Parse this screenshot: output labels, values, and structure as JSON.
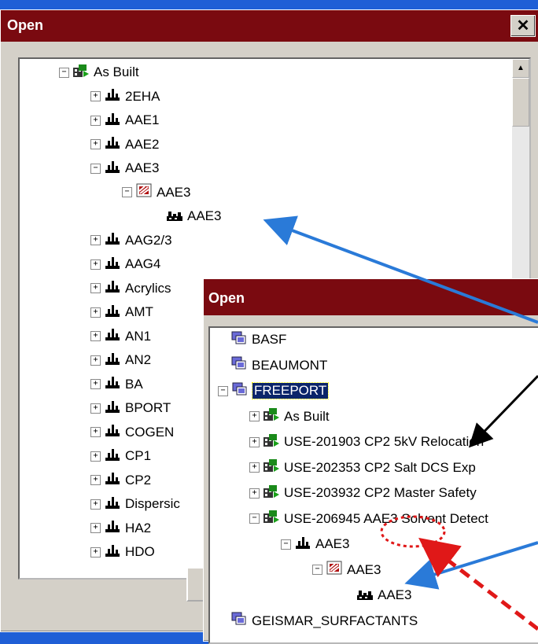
{
  "dialog_back": {
    "title": "Open",
    "close_glyph": "✕",
    "items": [
      {
        "label": "As Built",
        "expander": "⊟",
        "icon": "project-icon"
      },
      {
        "label": "2EHA",
        "expander": "⊞",
        "icon": "plant-icon"
      },
      {
        "label": "AAE1",
        "expander": "⊞",
        "icon": "plant-icon"
      },
      {
        "label": "AAE2",
        "expander": "⊞",
        "icon": "plant-icon"
      },
      {
        "label": "AAE3",
        "expander": "⊟",
        "icon": "plant-icon"
      },
      {
        "label": "AAE3",
        "expander": "⊟",
        "icon": "area-icon"
      },
      {
        "label": "AAE3",
        "expander": "",
        "icon": "unit-icon"
      },
      {
        "label": "AAG2/3",
        "expander": "⊞",
        "icon": "plant-icon"
      },
      {
        "label": "AAG4",
        "expander": "⊞",
        "icon": "plant-icon"
      },
      {
        "label": "Acrylics",
        "expander": "⊞",
        "icon": "plant-icon"
      },
      {
        "label": "AMT",
        "expander": "⊞",
        "icon": "plant-icon"
      },
      {
        "label": "AN1",
        "expander": "⊞",
        "icon": "plant-icon"
      },
      {
        "label": "AN2",
        "expander": "⊞",
        "icon": "plant-icon"
      },
      {
        "label": "BA",
        "expander": "⊞",
        "icon": "plant-icon"
      },
      {
        "label": "BPORT",
        "expander": "⊞",
        "icon": "plant-icon"
      },
      {
        "label": "COGEN",
        "expander": "⊞",
        "icon": "plant-icon"
      },
      {
        "label": "CP1",
        "expander": "⊞",
        "icon": "plant-icon"
      },
      {
        "label": "CP2",
        "expander": "⊞",
        "icon": "plant-icon"
      },
      {
        "label": "Dispersic",
        "expander": "⊞",
        "icon": "plant-icon"
      },
      {
        "label": "HA2",
        "expander": "⊞",
        "icon": "plant-icon"
      },
      {
        "label": "HDO",
        "expander": "⊞",
        "icon": "plant-icon"
      }
    ]
  },
  "dialog_front": {
    "title": "Open",
    "items": [
      {
        "label": "BASF",
        "expander": "",
        "icon": "site-icon"
      },
      {
        "label": "BEAUMONT",
        "expander": "",
        "icon": "site-icon"
      },
      {
        "label": "FREEPORT",
        "expander": "⊟",
        "icon": "site-icon",
        "selected": true
      },
      {
        "label": "As Built",
        "expander": "⊞",
        "icon": "project-icon"
      },
      {
        "label": "USE-201903 CP2 5kV Relocation",
        "expander": "⊞",
        "icon": "project-icon"
      },
      {
        "label": "USE-202353 CP2 Salt DCS Exp",
        "expander": "⊞",
        "icon": "project-icon"
      },
      {
        "label": "USE-203932 CP2 Master Safety",
        "expander": "⊞",
        "icon": "project-icon"
      },
      {
        "label": "USE-206945 AAE3 Solvent Detect",
        "expander": "⊟",
        "icon": "project-icon"
      },
      {
        "label": "AAE3",
        "expander": "⊟",
        "icon": "plant-icon"
      },
      {
        "label": "AAE3",
        "expander": "⊟",
        "icon": "area-icon"
      },
      {
        "label": "AAE3",
        "expander": "",
        "icon": "unit-icon"
      },
      {
        "label": "GEISMAR_SURFACTANTS",
        "expander": "",
        "icon": "site-icon"
      }
    ]
  },
  "colors": {
    "titlebar": "#7a0a10",
    "desktop": "#1f5fd6",
    "selection": "#0a246a",
    "arrow_blue": "#2a7ad8",
    "arrow_red": "#e01818"
  }
}
